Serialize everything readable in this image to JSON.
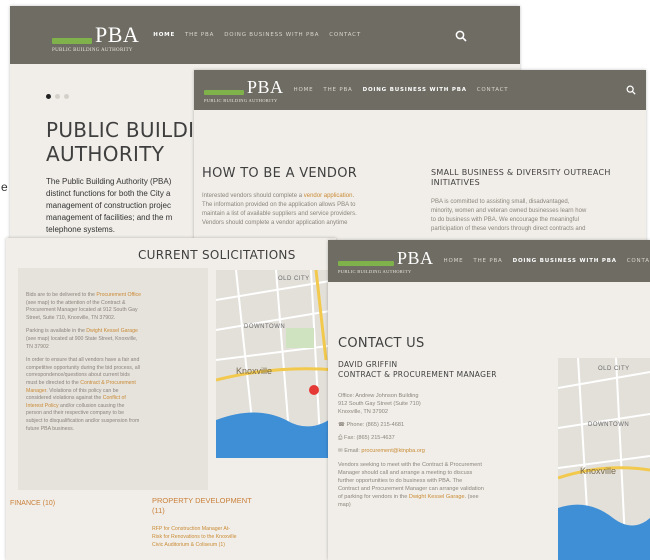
{
  "colors": {
    "nav_bg": "#6f6c63",
    "accent_green": "#7fb24a",
    "link_orange": "#c98b35",
    "page_bg": "#f1eee9",
    "map_water": "#3f8fd6"
  },
  "brand": {
    "name": "PBA",
    "tagline": "PUBLIC BUILDING AUTHORITY"
  },
  "nav": {
    "home": "HOME",
    "the_pba": "THE PBA",
    "doing_business": "DOING BUSINESS WITH PBA",
    "contact": "CONTACT",
    "search_icon": "search-icon"
  },
  "home": {
    "title_line1": "PUBLIC BUILDING",
    "title_line2": "AUTHORITY",
    "intro_1": "The Public Building Authority (PBA)",
    "intro_2": "distinct functions for both the City a",
    "intro_3": "management of construction projec",
    "intro_4": "management of facilities; and the m",
    "intro_5": "telephone systems.",
    "edge_letter": "e"
  },
  "vendor": {
    "title": "HOW TO BE A VENDOR",
    "p1_a": "Interested vendors should complete a ",
    "p1_link": "vendor application",
    "p1_b": ".",
    "p2": "The information provided on the application allows PBA to",
    "p3": "maintain a list of available suppliers and service providers.",
    "p4": "Vendors should complete a vendor application anytime",
    "side_title_1": "SMALL BUSINESS & DIVERSITY OUTREACH",
    "side_title_2": "INITIATIVES",
    "side_p1": "PBA is committed to assisting small, disadvantaged,",
    "side_p2": "minority, women and veteran owned businesses learn how",
    "side_p3": "to do business with PBA. We encourage the meaningful",
    "side_p4": "participation of these vendors through direct contracts and"
  },
  "solicitations": {
    "title": "CURRENT SOLICITATIONS",
    "b1_a": "Bids are to be delivered to the ",
    "b1_link": "Procurement Office",
    "b1_b": "(see map) to the attention of the Contract &",
    "b1_c": "Procurement Manager located at 912 South Gay",
    "b1_d": "Street, Suite 710, Knoxville, TN 37902.",
    "b2_a": "Parking is available in the ",
    "b2_link": "Dwight Kessel Garage",
    "b2_b": "(see map) located at 900 State Street, Knoxville,",
    "b2_c": "TN 37902",
    "b3_a": "In order to ensure that all vendors have a fair and",
    "b3_b": "competitive opportunity during the bid process, all",
    "b3_c": "correspondence/questions about current bids",
    "b3_d": "must be directed to the ",
    "b3_link1": "Contract & Procurement",
    "b3_link2": "Manager",
    "b3_e": ". Violations of this policy can be",
    "b3_f": "considered violations against the ",
    "b3_link3": "Conflict of",
    "b3_link4": "Interest Policy",
    "b3_g": " and/or collusion causing the",
    "b3_h": "person and their respective company to be",
    "b3_i": "subject to disqualification and/or suspension from",
    "b3_j": "future PBA business.",
    "finance_label": "FINANCE (10)",
    "property_label_1": "PROPERTY DEVELOPMENT",
    "property_label_2": "(11)",
    "item1_1": "RFP for Construction Manager At-",
    "item1_2": "Risk for Renovations to the Knoxville",
    "item1_3": "Civic Auditorium & Coliseum (1)"
  },
  "contact": {
    "title": "CONTACT US",
    "name": "DAVID GRIFFIN",
    "role": "CONTRACT & PROCUREMENT MANAGER",
    "office_1": "Office: Andrew Johnson Building",
    "office_2": "912 South Gay Street (Suite 710)",
    "office_3": "Knoxville, TN 37902",
    "phone": "Phone: (865) 215-4681",
    "fax": "Fax: (865) 215-4637",
    "email_label": "Email: ",
    "email": "procurement@ktnpba.org",
    "p1": "Vendors seeking to meet with the Contract & Procurement",
    "p2": "Manager should call and arrange a meeting to discuss",
    "p3": "further opportunities to do business with PBA. The",
    "p4": "Contract and Procurement Manager can arrange validation",
    "p5_a": "of parking for vendors in the ",
    "p5_link": "Dwight Kessel Garage",
    "p5_b": ". (see",
    "p6": "map)"
  },
  "map": {
    "label_old_city": "OLD CITY",
    "label_downtown": "DOWNTOWN",
    "label_knoxville": "Knoxville"
  }
}
